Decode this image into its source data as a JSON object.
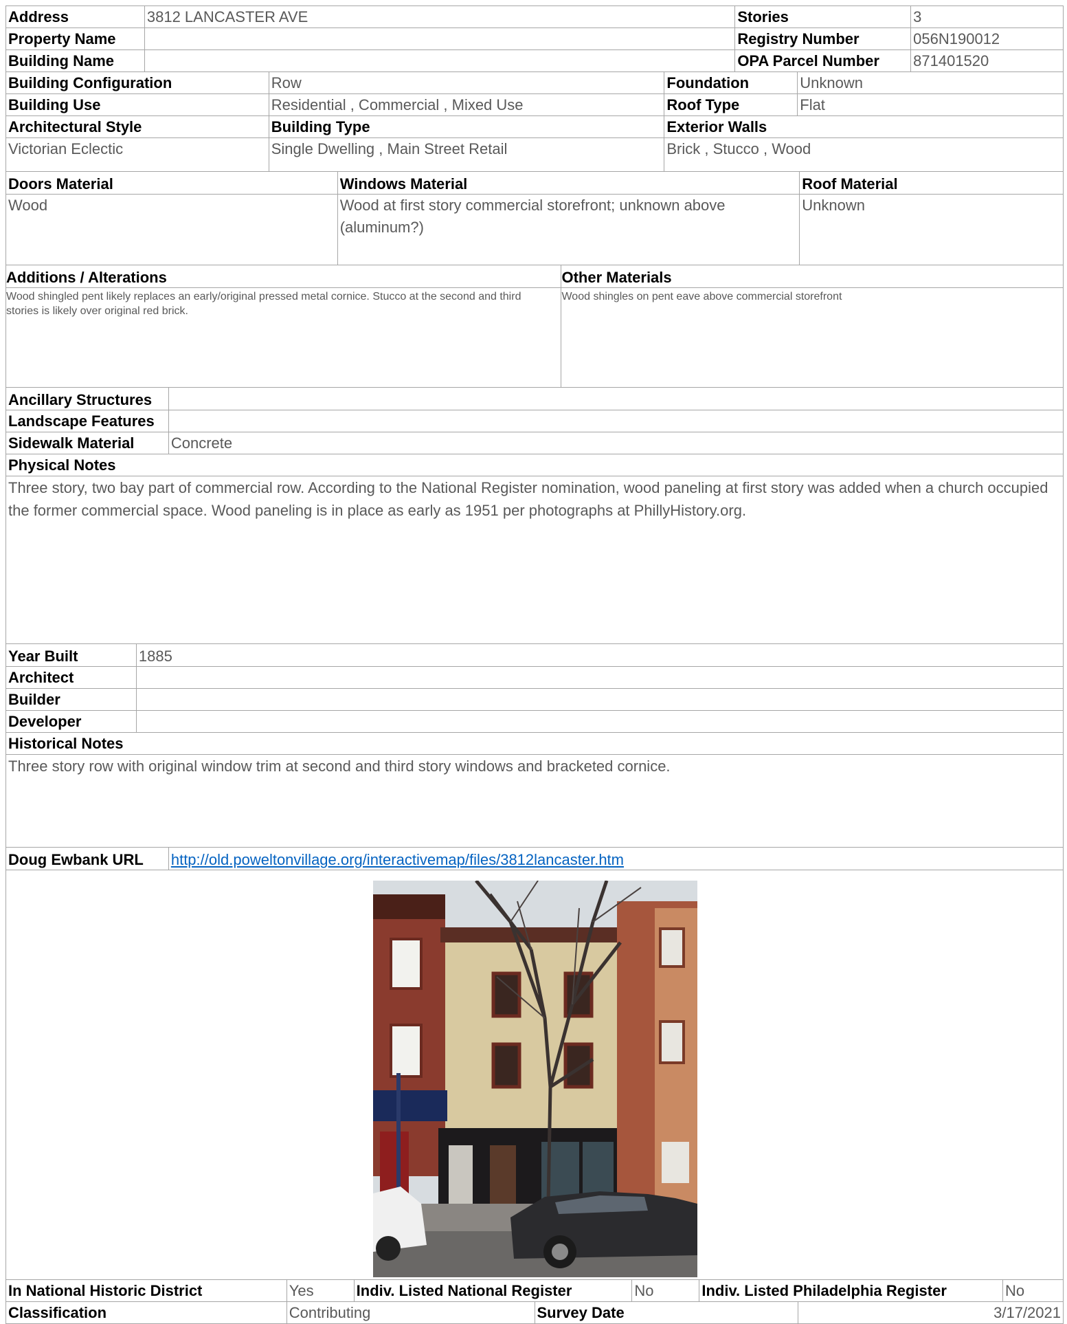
{
  "header": {
    "address_label": "Address",
    "address": "3812 LANCASTER AVE",
    "stories_label": "Stories",
    "stories": "3",
    "property_name_label": "Property Name",
    "property_name": "",
    "registry_label": "Registry Number",
    "registry": "056N190012",
    "building_name_label": "Building Name",
    "building_name": "",
    "opa_label": "OPA Parcel Number",
    "opa": "871401520"
  },
  "config": {
    "building_config_label": "Building Configuration",
    "building_config": "Row",
    "foundation_label": "Foundation",
    "foundation": "Unknown",
    "building_use_label": "Building Use",
    "building_use": "Residential , Commercial , Mixed Use",
    "roof_type_label": "Roof Type",
    "roof_type": "Flat",
    "arch_style_label": "Architectural Style",
    "arch_style": "Victorian Eclectic",
    "building_type_label": "Building Type",
    "building_type": "Single Dwelling , Main Street Retail",
    "exterior_walls_label": "Exterior Walls",
    "exterior_walls": "Brick , Stucco , Wood"
  },
  "materials": {
    "doors_label": "Doors Material",
    "doors": "Wood",
    "windows_label": "Windows Material",
    "windows": "Wood at first story commercial storefront; unknown above (aluminum?)",
    "roof_label": "Roof Material",
    "roof": "Unknown"
  },
  "alterations": {
    "label": "Additions / Alterations",
    "text": "Wood shingled pent likely replaces an early/original pressed metal cornice.  Stucco at the second and third stories is likely over original red brick.",
    "other_label": "Other Materials",
    "other": "Wood shingles on pent eave above commercial storefront"
  },
  "site": {
    "ancillary_label": "Ancillary Structures",
    "ancillary": "",
    "landscape_label": "Landscape Features",
    "landscape": "",
    "sidewalk_label": "Sidewalk Material",
    "sidewalk": "Concrete"
  },
  "physical_notes": {
    "label": "Physical Notes",
    "text": "Three story, two bay part of commercial row. According to the National Register nomination, wood paneling at first story was added when a church occupied the former commercial space. Wood paneling is in place as early as 1951 per photographs at PhillyHistory.org."
  },
  "history": {
    "year_label": "Year Built",
    "year": "1885",
    "architect_label": "Architect",
    "architect": "",
    "builder_label": "Builder",
    "builder": "",
    "developer_label": "Developer",
    "developer": "",
    "notes_label": "Historical Notes",
    "notes": "Three story row with original window trim at second and third story windows and bracketed cornice."
  },
  "ewbank": {
    "label": "Doug Ewbank URL",
    "url": "http://old.poweltonvillage.org/interactivemap/files/3812lancaster.htm"
  },
  "footer": {
    "district_label": "In National Historic District",
    "district": "Yes",
    "national_label": "Indiv. Listed National Register",
    "national": "No",
    "phila_label": "Indiv. Listed Philadelphia Register",
    "phila": "No",
    "classification_label": "Classification",
    "classification": "Contributing",
    "survey_label": "Survey Date",
    "survey": "3/17/2021"
  },
  "colors": {
    "border": "#a6a6a6",
    "value_text": "#595959",
    "link": "#0563c1"
  }
}
